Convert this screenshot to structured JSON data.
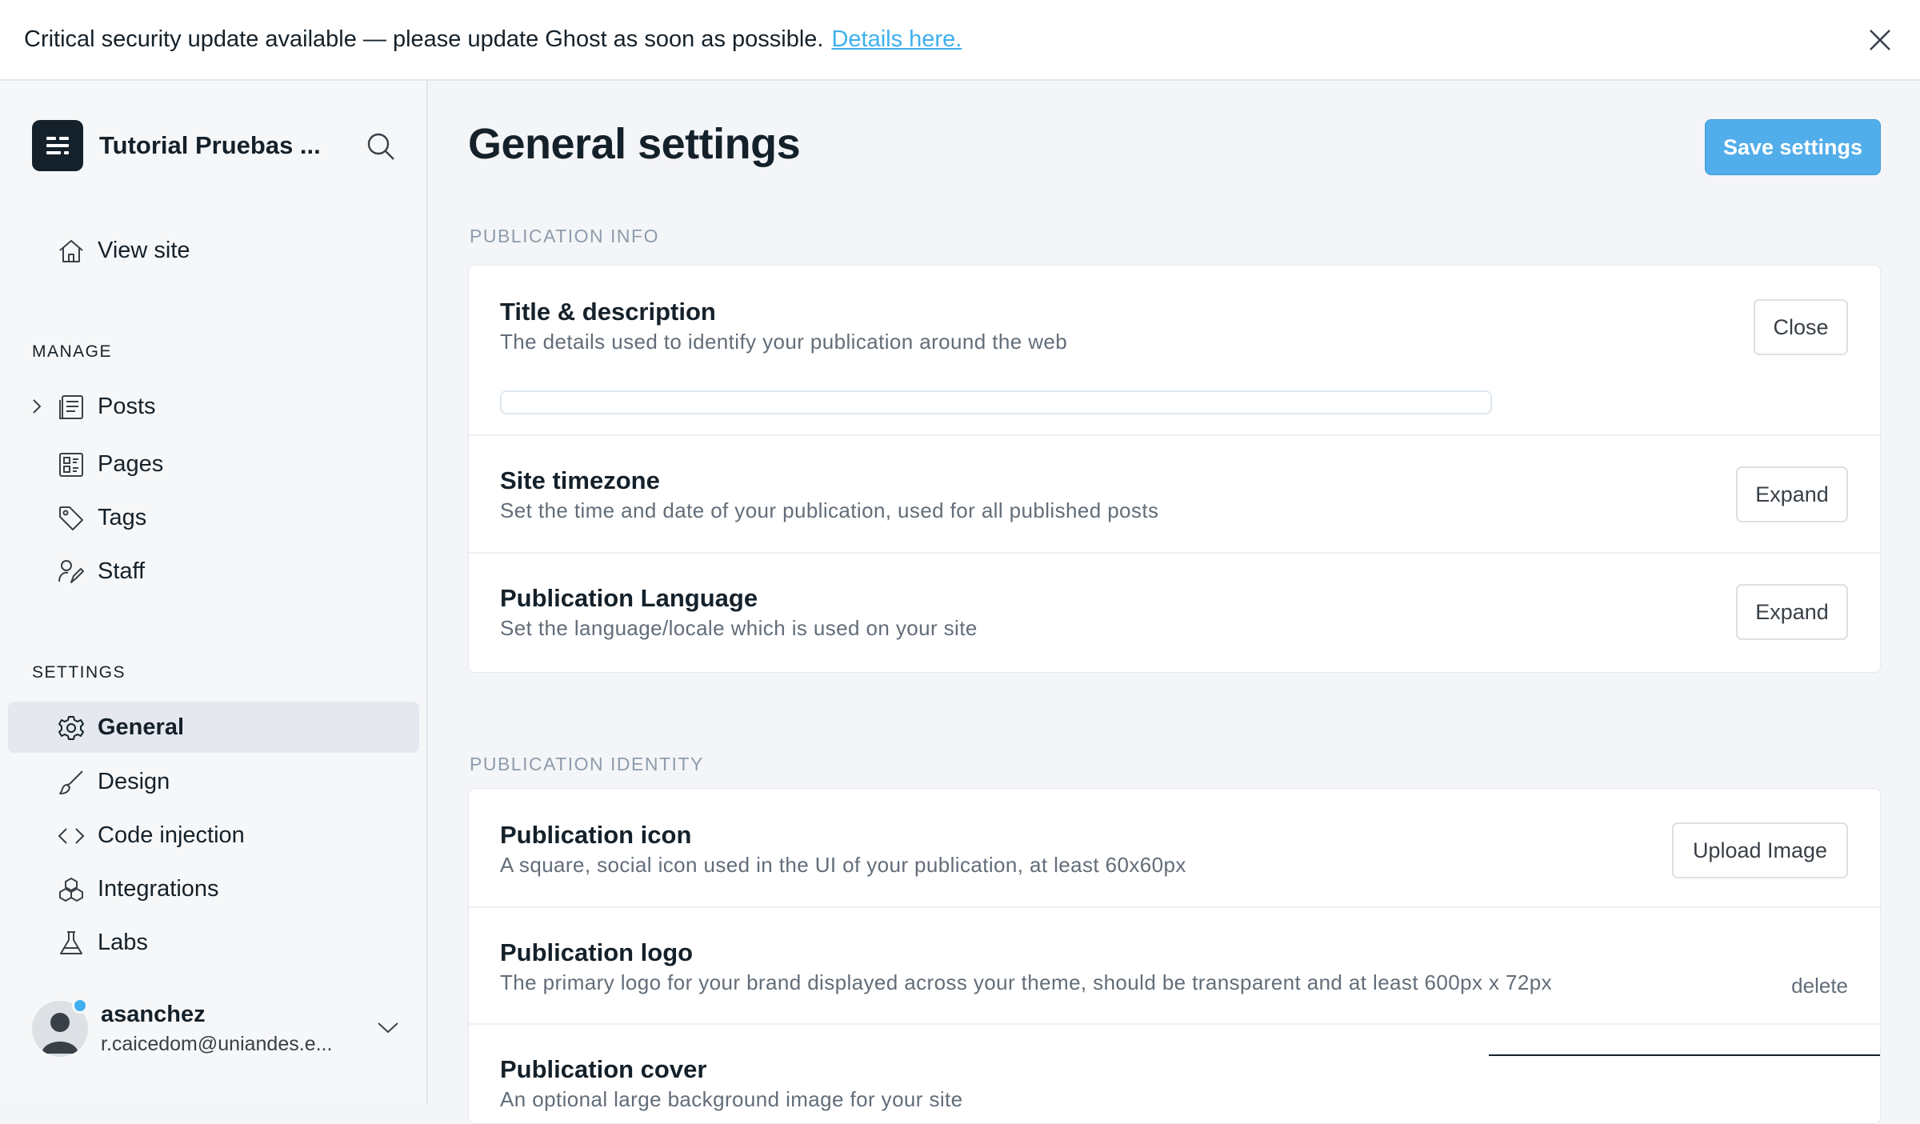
{
  "banner": {
    "message": "Critical security update available — please update Ghost as soon as possible.",
    "link_label": "Details here."
  },
  "sidebar": {
    "site_name": "Tutorial Pruebas ...",
    "view_site": "View site",
    "manage_label": "MANAGE",
    "manage_items": [
      {
        "label": "Posts",
        "icon": "posts-icon"
      },
      {
        "label": "Pages",
        "icon": "pages-icon"
      },
      {
        "label": "Tags",
        "icon": "tag-icon"
      },
      {
        "label": "Staff",
        "icon": "staff-icon"
      }
    ],
    "settings_label": "SETTINGS",
    "settings_items": [
      {
        "label": "General",
        "icon": "gear-icon",
        "active": true
      },
      {
        "label": "Design",
        "icon": "brush-icon"
      },
      {
        "label": "Code injection",
        "icon": "code-icon"
      },
      {
        "label": "Integrations",
        "icon": "integrations-icon"
      },
      {
        "label": "Labs",
        "icon": "flask-icon"
      }
    ],
    "user": {
      "name": "asanchez",
      "email": "r.caicedom@uniandes.e..."
    }
  },
  "main": {
    "title": "General settings",
    "save_label": "Save settings",
    "publication_info": {
      "label": "PUBLICATION INFO",
      "rows": [
        {
          "title": "Title & description",
          "desc": "The details used to identify your publication around the web",
          "button": "Close"
        },
        {
          "title": "Site timezone",
          "desc": "Set the time and date of your publication, used for all published posts",
          "button": "Expand"
        },
        {
          "title": "Publication Language",
          "desc": "Set the language/locale which is used on your site",
          "button": "Expand"
        }
      ]
    },
    "publication_identity": {
      "label": "PUBLICATION IDENTITY",
      "rows": [
        {
          "title": "Publication icon",
          "desc": "A square, social icon used in the UI of your publication, at least 60x60px",
          "button": "Upload Image"
        },
        {
          "title": "Publication logo",
          "desc": "The primary logo for your brand displayed across your theme, should be transparent and at least 600px x 72px",
          "link": "delete"
        },
        {
          "title": "Publication cover",
          "desc": "An optional large background image for your site"
        }
      ]
    }
  },
  "colors": {
    "accent": "#3eb0ef",
    "save_button": "#52aeea",
    "brand_dark": "#15212a"
  }
}
